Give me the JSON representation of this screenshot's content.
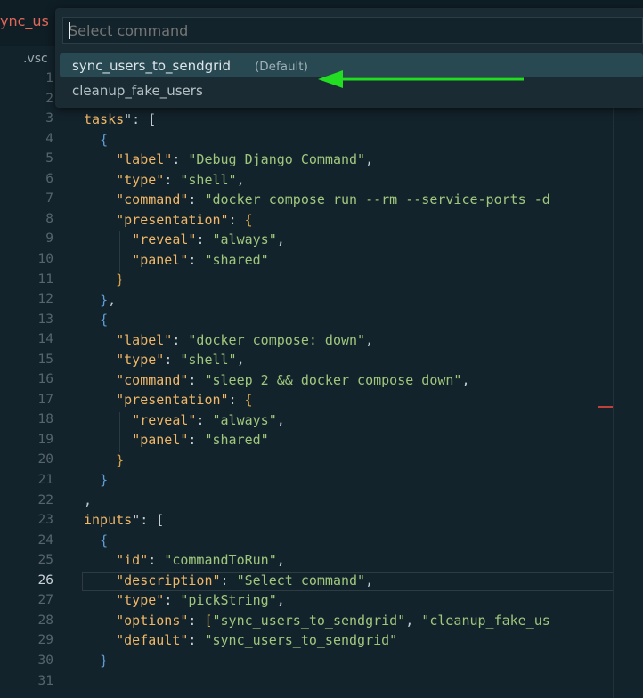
{
  "tab": {
    "label": "ync_us"
  },
  "breadcrumb": {
    "label": ".vsc"
  },
  "palette": {
    "placeholder": "Select command",
    "items": [
      {
        "label": "sync_users_to_sendgrid",
        "description": "(Default)",
        "selected": true
      },
      {
        "label": "cleanup_fake_users",
        "description": "",
        "selected": false
      }
    ]
  },
  "editor": {
    "active_line": 26,
    "line_numbers": [
      "1",
      "2",
      "3",
      "4",
      "5",
      "6",
      "7",
      "8",
      "9",
      "10",
      "11",
      "12",
      "13",
      "14",
      "15",
      "16",
      "17",
      "18",
      "19",
      "20",
      "21",
      "22",
      "23",
      "24",
      "25",
      "26",
      "27",
      "28",
      "29",
      "30",
      "31"
    ],
    "lines": {
      "l3_key": "tasks",
      "l3_rest": "\": [",
      "l5_key": "\"label\"",
      "l5_val": "\"Debug Django Command\"",
      "l6_key": "\"type\"",
      "l6_val": "\"shell\"",
      "l7_key": "\"command\"",
      "l7_val": "\"docker compose run --rm --service-ports -d",
      "l8_key": "\"presentation\"",
      "l9_key": "\"reveal\"",
      "l9_val": "\"always\"",
      "l10_key": "\"panel\"",
      "l10_val": "\"shared\"",
      "l14_key": "\"label\"",
      "l14_val": "\"docker compose: down\"",
      "l15_key": "\"type\"",
      "l15_val": "\"shell\"",
      "l16_key": "\"command\"",
      "l16_val": "\"sleep 2 && docker compose down\"",
      "l17_key": "\"presentation\"",
      "l18_key": "\"reveal\"",
      "l18_val": "\"always\"",
      "l19_key": "\"panel\"",
      "l19_val": "\"shared\"",
      "l23_key": "inputs",
      "l23_rest": "\": [",
      "l25_key": "\"id\"",
      "l25_val": "\"commandToRun\"",
      "l26_key": "\"description\"",
      "l26_val": "\"Select command\"",
      "l27_key": "\"type\"",
      "l27_val": "\"pickString\"",
      "l28_key": "\"options\"",
      "l28_val1": "\"sync_users_to_sendgrid\"",
      "l28_val2": "\"cleanup_fake_us",
      "l29_key": "\"default\"",
      "l29_val": "\"sync_users_to_sendgrid\""
    }
  },
  "colors": {
    "accent_arrow": "#22dd22",
    "keyword": "#f0b767",
    "string": "#9fc77c",
    "tab_text": "#e0675a"
  }
}
